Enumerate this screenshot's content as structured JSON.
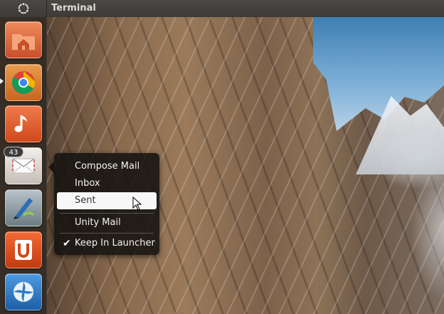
{
  "top_panel": {
    "window_title": "Terminal",
    "bfb_icon": "ubuntu-logo-icon"
  },
  "launcher": {
    "items": [
      {
        "name": "home-folder",
        "icon": "folder-home-icon",
        "color": "#e06a37"
      },
      {
        "name": "chrome",
        "icon": "chrome-icon",
        "color": "#d96a2a"
      },
      {
        "name": "music",
        "icon": "music-note-icon",
        "color": "#e0562a"
      },
      {
        "name": "mail",
        "icon": "envelope-icon",
        "color": "#d8d4cf",
        "badge": "43"
      },
      {
        "name": "inkscape",
        "icon": "inkscape-icon",
        "color": "#8a9aa0"
      },
      {
        "name": "ubuntu-one",
        "icon": "ubuntu-one-icon",
        "color": "#e04e1f"
      },
      {
        "name": "shotwell",
        "icon": "shutter-icon",
        "color": "#2d79c4"
      }
    ]
  },
  "quicklist": {
    "items": [
      {
        "label": "Compose Mail",
        "selected": false
      },
      {
        "label": "Inbox",
        "selected": false
      },
      {
        "label": "Sent",
        "selected": true
      },
      {
        "label": "Unity Mail",
        "selected": false
      },
      {
        "label": "Keep In Launcher",
        "checked": true
      }
    ],
    "check_glyph": "✔"
  }
}
